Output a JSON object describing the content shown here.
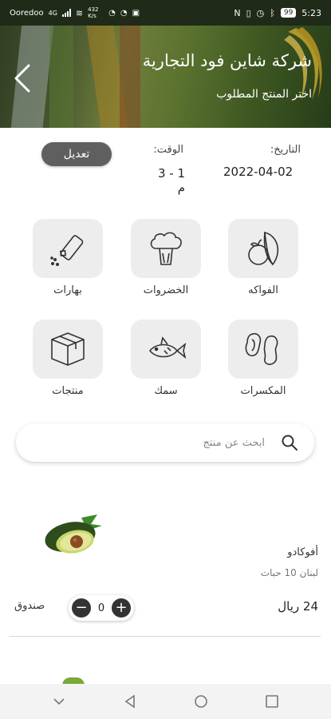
{
  "status_bar": {
    "carrier": "Ooredoo",
    "network": "4G",
    "speed": "432 K/s",
    "battery": "99",
    "time": "5:23"
  },
  "header": {
    "company_name": "شركة شاين فود التجارية",
    "subtitle": "اختر المنتج المطلوب"
  },
  "order_info": {
    "date_label": "التاريخ:",
    "date_value": "2022-04-02",
    "time_label": "الوقت:",
    "time_value": "1 - 3 م",
    "edit_label": "تعديل"
  },
  "categories": [
    {
      "label": "الفواكه",
      "icon": "fruits-icon"
    },
    {
      "label": "الخضروات",
      "icon": "broccoli-icon"
    },
    {
      "label": "بهارات",
      "icon": "spice-shaker-icon"
    },
    {
      "label": "المكسرات",
      "icon": "nuts-icon"
    },
    {
      "label": "سمك",
      "icon": "fish-icon"
    },
    {
      "label": "منتجات",
      "icon": "box-icon"
    }
  ],
  "search": {
    "placeholder": "ابحث عن منتج"
  },
  "product": {
    "name": "أفوكادو",
    "description": "لبنان 10 حبات",
    "price": "24 ريال",
    "quantity": "0",
    "unit": "صندوق"
  }
}
